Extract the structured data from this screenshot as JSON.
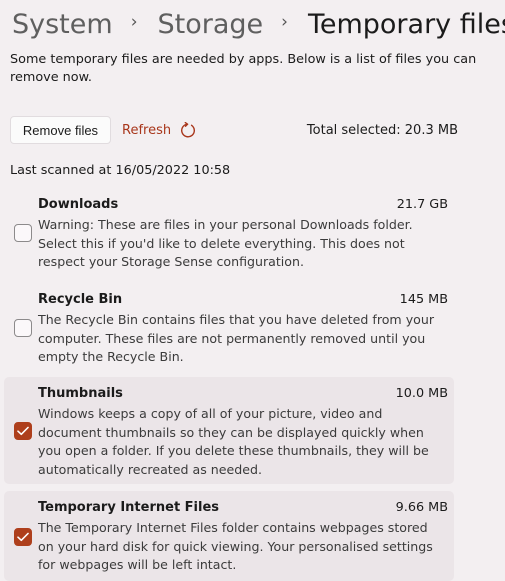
{
  "breadcrumb": [
    "System",
    "Storage",
    "Temporary files"
  ],
  "intro": "Some temporary files are needed by apps. Below is a list of files you can remove now.",
  "toolbar": {
    "remove_label": "Remove files",
    "refresh_label": "Refresh",
    "total_selected": "Total selected: 20.3 MB"
  },
  "last_scanned": "Last scanned at 16/05/2022 10:58",
  "accent_color": "#ae3f1c",
  "items": [
    {
      "name": "Downloads",
      "size": "21.7 GB",
      "checked": false,
      "desc": "Warning: These are files in your personal Downloads folder. Select this if you'd like to delete everything. This does not respect your Storage Sense configuration."
    },
    {
      "name": "Recycle Bin",
      "size": "145 MB",
      "checked": false,
      "desc": "The Recycle Bin contains files that you have deleted from your computer. These files are not permanently removed until you empty the Recycle Bin."
    },
    {
      "name": "Thumbnails",
      "size": "10.0 MB",
      "checked": true,
      "desc": "Windows keeps a copy of all of your picture, video and document thumbnails so they can be displayed quickly when you open a folder. If you delete these thumbnails, they will be automatically recreated as needed."
    },
    {
      "name": "Temporary Internet Files",
      "size": "9.66 MB",
      "checked": true,
      "desc": "The Temporary Internet Files folder contains webpages stored on your hard disk for quick viewing. Your personalised settings for webpages will be left intact."
    }
  ]
}
